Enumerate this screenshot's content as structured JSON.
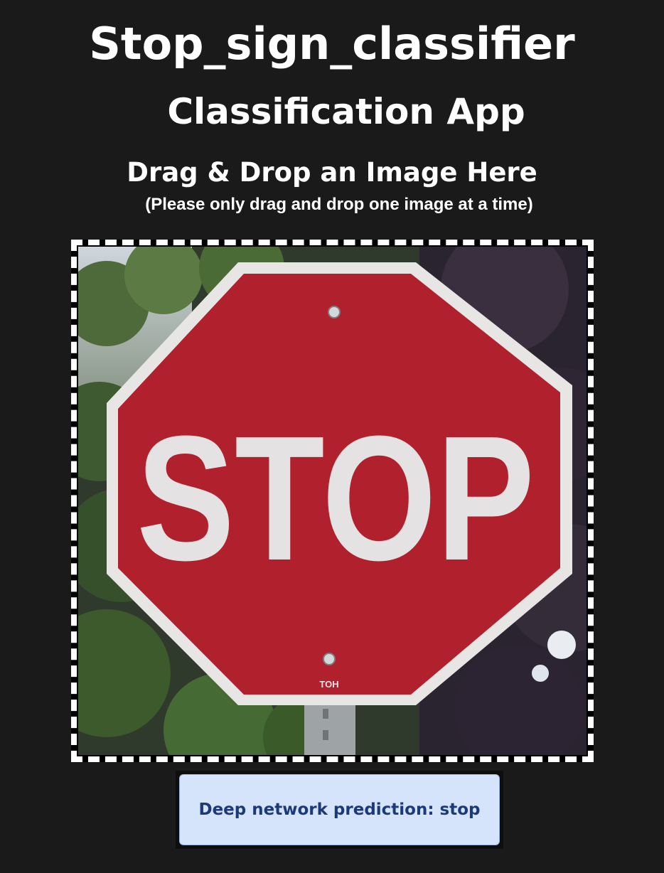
{
  "header": {
    "title": "Stop_sign_classifier",
    "subtitle": "Classification App",
    "drop_heading": "Drag & Drop an Image Here",
    "drop_note": "(Please only drag and drop one image at a time)"
  },
  "image": {
    "sign_text": "STOP",
    "sign_mark": "TOH",
    "sign_color": "#b0202d",
    "border_color": "#e8e6e4"
  },
  "result": {
    "prediction_label": "Deep network prediction: stop"
  },
  "colors": {
    "background": "#1a1a1a",
    "result_bg": "#d6e4fb",
    "result_text": "#1c3a7a"
  }
}
